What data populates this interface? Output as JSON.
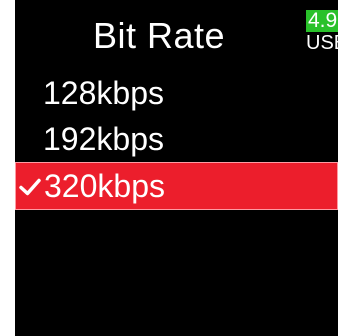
{
  "header": {
    "title": "Bit Rate",
    "battery": {
      "level": "4.9",
      "source": "USB",
      "level_color": "#29c12a"
    }
  },
  "menu": {
    "selected_index": 2,
    "highlight_color": "#ec1e2c",
    "items": [
      {
        "label": "128kbps",
        "icon": null
      },
      {
        "label": "192kbps",
        "icon": null
      },
      {
        "label": "320kbps",
        "icon": "check-icon"
      }
    ]
  }
}
